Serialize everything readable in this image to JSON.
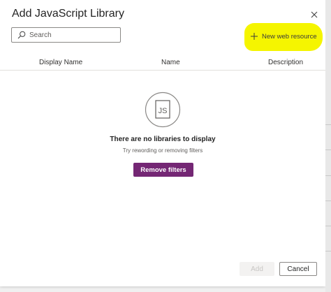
{
  "dialog": {
    "title": "Add JavaScript Library",
    "close_icon": "close-icon"
  },
  "toolbar": {
    "search_placeholder": "Search",
    "search_icon": "search-icon",
    "new_resource_label": "New web resource",
    "new_resource_icon": "plus-icon",
    "highlight_color": "#f5f500"
  },
  "table": {
    "columns": [
      "Display Name",
      "Name",
      "Description"
    ]
  },
  "empty_state": {
    "icon_text": "JS",
    "title": "There are no libraries to display",
    "subtitle": "Try rewording or removing filters",
    "remove_filters_label": "Remove filters",
    "button_color": "#742774"
  },
  "footer": {
    "add_label": "Add",
    "add_disabled": true,
    "cancel_label": "Cancel"
  }
}
